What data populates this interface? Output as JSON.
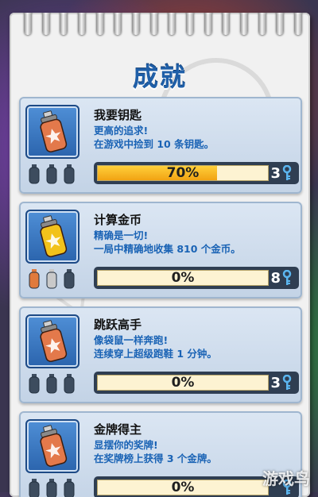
{
  "title": "成就",
  "achievements": [
    {
      "name": "我要钥匙",
      "desc1": "更高的追求!",
      "desc2": "在游戏中捡到 10 条钥匙。",
      "progress": 0.7,
      "progress_text": "70%",
      "reward": "3",
      "can_color": "#e3794b",
      "tiers": [
        "empty",
        "empty",
        "empty"
      ]
    },
    {
      "name": "计算金币",
      "desc1": "精确是一切!",
      "desc2": "一局中精确地收集 810 个金币。",
      "progress": 0,
      "progress_text": "0%",
      "reward": "8",
      "can_color": "#f2c21b",
      "tiers": [
        "bronze",
        "silver",
        "empty"
      ]
    },
    {
      "name": "跳跃高手",
      "desc1": "像袋鼠一样奔跑!",
      "desc2": "连续穿上超级跑鞋 1 分钟。",
      "progress": 0,
      "progress_text": "0%",
      "reward": "3",
      "can_color": "#e3794b",
      "tiers": [
        "empty",
        "empty",
        "empty"
      ]
    },
    {
      "name": "金牌得主",
      "desc1": "显摆你的奖牌!",
      "desc2": "在奖牌榜上获得 3 个金牌。",
      "progress": 0,
      "progress_text": "0%",
      "reward": "",
      "can_color": "#e3794b",
      "tiers": [
        "empty",
        "empty",
        "empty"
      ]
    }
  ],
  "icons": {
    "can": "spray-can-icon",
    "tier": "spray-can-silhouette-icon",
    "reward": "key-icon"
  },
  "colors": {
    "title": "#1f5fa8",
    "desc": "#1a63b5",
    "progress_fill": "#f1a313",
    "key": "#5bb6f0"
  },
  "watermark": "游戏鸟"
}
